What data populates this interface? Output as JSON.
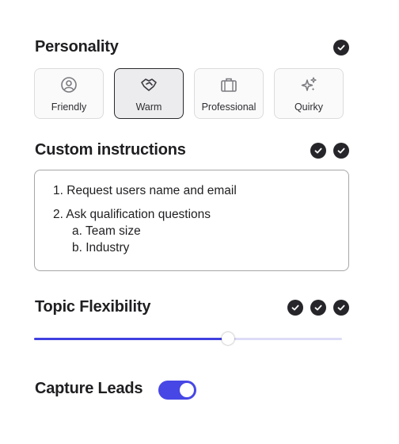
{
  "personality": {
    "title": "Personality",
    "checks": 1,
    "options": [
      {
        "label": "Friendly",
        "icon": "smiley-face-icon",
        "selected": false
      },
      {
        "label": "Warm",
        "icon": "handshake-icon",
        "selected": true
      },
      {
        "label": "Professional",
        "icon": "briefcase-icon",
        "selected": false
      },
      {
        "label": "Quirky",
        "icon": "sparkles-icon",
        "selected": false
      }
    ]
  },
  "custom_instructions": {
    "title": "Custom instructions",
    "checks": 2,
    "lines": [
      {
        "marker": "1.",
        "text": "Request users name and email"
      },
      {
        "marker": "2.",
        "text": "Ask qualification questions"
      },
      {
        "marker": "a.",
        "text": "Team size"
      },
      {
        "marker": "b.",
        "text": "Industry"
      }
    ]
  },
  "topic_flexibility": {
    "title": "Topic Flexibility",
    "checks": 3,
    "value_percent": 63
  },
  "capture_leads": {
    "title": "Capture Leads",
    "enabled": true
  },
  "colors": {
    "accent": "#4747e6",
    "check_bg": "#26262a"
  }
}
